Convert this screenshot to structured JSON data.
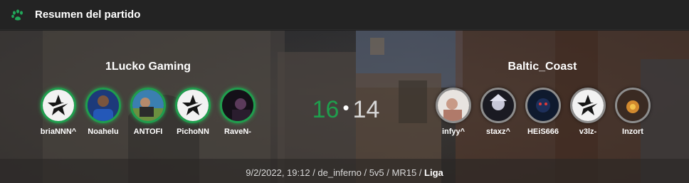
{
  "header": {
    "title": "Resumen del partido",
    "icon": "paw-icon"
  },
  "colors": {
    "win": "#1f9e4d",
    "lose": "#8d8d8d",
    "header_bg": "#232323"
  },
  "team_left": {
    "name": "1Lucko Gaming",
    "score": "16",
    "players": [
      {
        "name": "briaNNN^",
        "avatar": "star-logo"
      },
      {
        "name": "Noahelu",
        "avatar": "photo"
      },
      {
        "name": "ANTOFI",
        "avatar": "photo"
      },
      {
        "name": "PichoNN",
        "avatar": "star-logo"
      },
      {
        "name": "RaveN-",
        "avatar": "photo"
      }
    ]
  },
  "separator": "•",
  "team_right": {
    "name": "Baltic_Coast",
    "score": "14",
    "players": [
      {
        "name": "infyy^",
        "avatar": "photo"
      },
      {
        "name": "staxz^",
        "avatar": "photo"
      },
      {
        "name": "HEiS666",
        "avatar": "photo"
      },
      {
        "name": "v3lz-",
        "avatar": "star-logo"
      },
      {
        "name": "Inzort",
        "avatar": "photo"
      }
    ]
  },
  "match_info": {
    "details": "9/2/2022, 19:12 / de_inferno / 5v5 / MR15 / ",
    "league": "Liga"
  }
}
